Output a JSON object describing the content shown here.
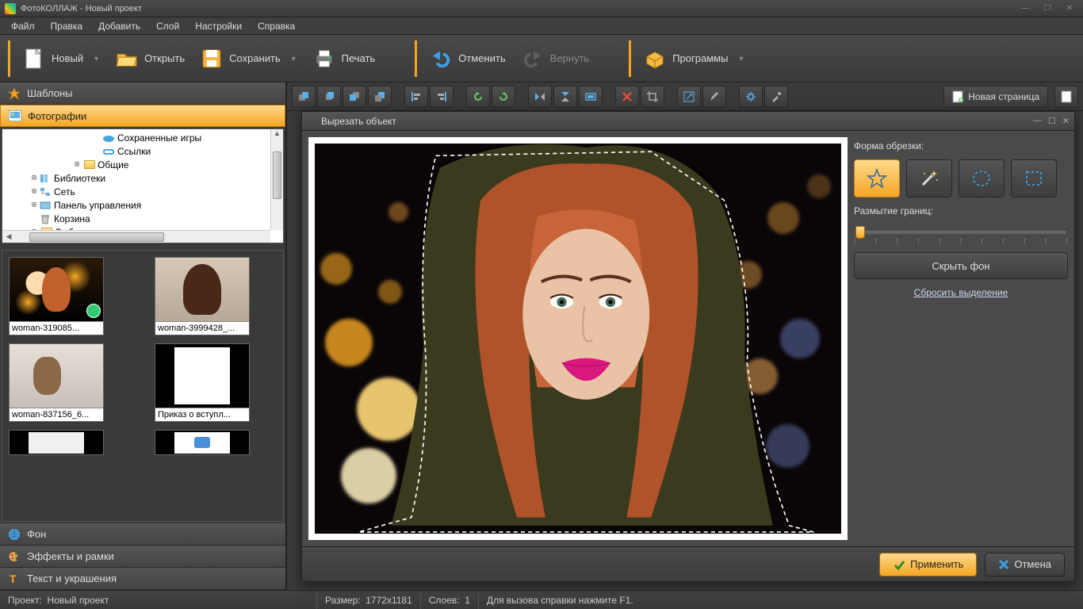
{
  "title": "ФотоКОЛЛАЖ - Новый проект",
  "menu": [
    "Файл",
    "Правка",
    "Добавить",
    "Слой",
    "Настройки",
    "Справка"
  ],
  "toolbar": {
    "new": "Новый",
    "open": "Открыть",
    "save": "Сохранить",
    "print": "Печать",
    "undo": "Отменить",
    "redo": "Вернуть",
    "programs": "Программы"
  },
  "left": {
    "templates": "Шаблоны",
    "photos": "Фотографии",
    "background": "Фон",
    "effects": "Эффекты и рамки",
    "text": "Текст и украшения",
    "tree": {
      "saved_games": "Сохраненные игры",
      "links": "Ссылки",
      "common": "Общие",
      "libraries": "Библиотеки",
      "network": "Сеть",
      "control_panel": "Панель управления",
      "trash": "Корзина",
      "lyuba": "Люба"
    },
    "thumbs": [
      "woman-319085...",
      "woman-3999428_...",
      "woman-837156_6...",
      "Приказ о вступл..."
    ]
  },
  "action_bar": {
    "new_page": "Новая страница"
  },
  "dialog": {
    "title": "Вырезать объект",
    "crop_shape": "Форма обрезки:",
    "blur": "Размытие границ:",
    "hide_bg": "Скрыть фон",
    "reset": "Сбросить выделение",
    "apply": "Применить",
    "cancel": "Отмена"
  },
  "status": {
    "project_label": "Проект:",
    "project_name": "Новый проект",
    "size_label": "Размер:",
    "size_value": "1772x1181",
    "layers_label": "Слоев:",
    "layers_value": "1",
    "help": "Для вызова справки нажмите F1."
  }
}
